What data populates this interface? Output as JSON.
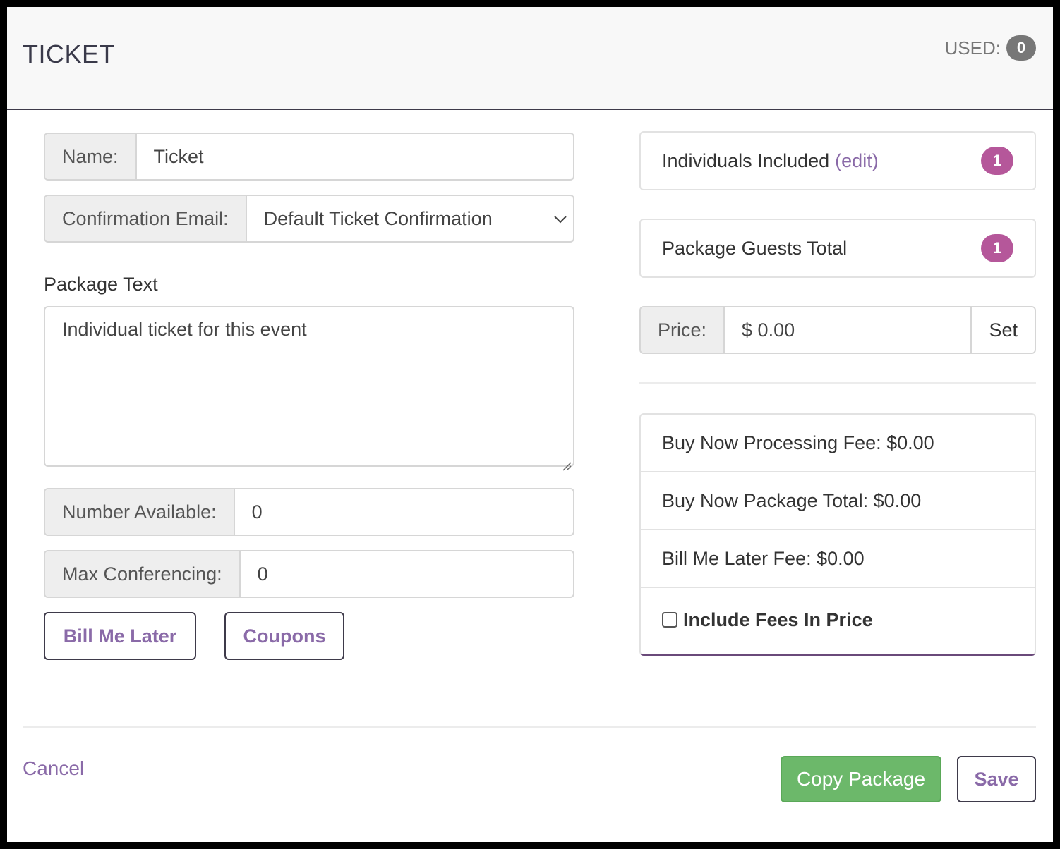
{
  "header": {
    "title": "TICKET",
    "used_label": "USED:",
    "used_count": "0"
  },
  "form": {
    "name_label": "Name:",
    "name_value": "Ticket",
    "confirmation_label": "Confirmation Email:",
    "confirmation_value": "Default Ticket Confirmation",
    "package_text_label": "Package Text",
    "package_text_value": "Individual ticket for this event",
    "number_available_label": "Number Available:",
    "number_available_value": "0",
    "max_conferencing_label": "Max Conferencing:",
    "max_conferencing_value": "0",
    "bill_me_later_button": "Bill Me Later",
    "coupons_button": "Coupons"
  },
  "summary": {
    "individuals_label": "Individuals Included",
    "individuals_edit": "(edit)",
    "individuals_count": "1",
    "guests_label": "Package Guests Total",
    "guests_count": "1",
    "price_label": "Price:",
    "price_value": "$ 0.00",
    "set_button": "Set"
  },
  "fees": {
    "processing_fee": "Buy Now Processing Fee: $0.00",
    "package_total": "Buy Now Package Total: $0.00",
    "bill_later_fee": "Bill Me Later Fee: $0.00",
    "include_fees_label": "Include Fees In Price"
  },
  "footer": {
    "cancel": "Cancel",
    "copy_package": "Copy Package",
    "save": "Save"
  },
  "colors": {
    "accent_purple": "#8a6aa8",
    "badge_pink": "#b5579a",
    "success_green": "#6cb86a"
  }
}
